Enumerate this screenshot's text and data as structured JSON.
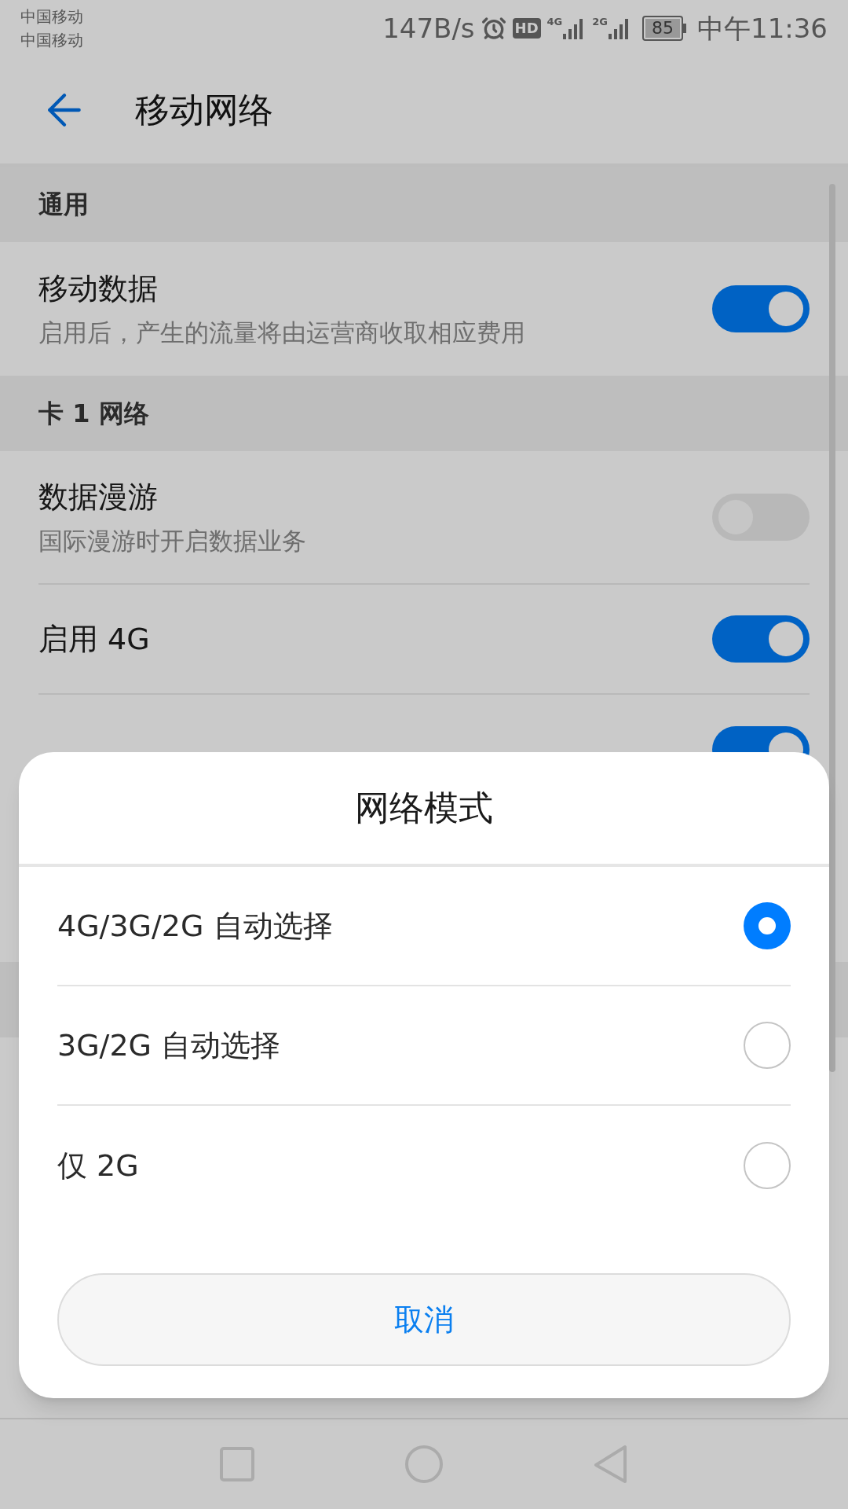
{
  "status_bar": {
    "carriers": [
      "中国移动",
      "中国移动"
    ],
    "speed": "147B/s",
    "hd": "HD",
    "sim1_network": "4G",
    "sim2_network": "2G",
    "battery": "85",
    "time": "中午11:36"
  },
  "app_bar": {
    "title": "移动网络"
  },
  "sections": [
    {
      "header": "通用",
      "items": [
        {
          "title": "移动数据",
          "subtitle": "启用后，产生的流量将由运营商收取相应费用",
          "on": true
        }
      ]
    },
    {
      "header": "卡 1 网络",
      "items": [
        {
          "title": "数据漫游",
          "subtitle": "国际漫游时开启数据业务",
          "on": false
        },
        {
          "title": "启用 4G",
          "on": true
        },
        {
          "on": true
        }
      ]
    }
  ],
  "dialog": {
    "title": "网络模式",
    "options": [
      {
        "label": "4G/3G/2G 自动选择",
        "selected": true
      },
      {
        "label": "3G/2G 自动选择",
        "selected": false
      },
      {
        "label": "仅 2G",
        "selected": false
      }
    ],
    "cancel": "取消"
  }
}
